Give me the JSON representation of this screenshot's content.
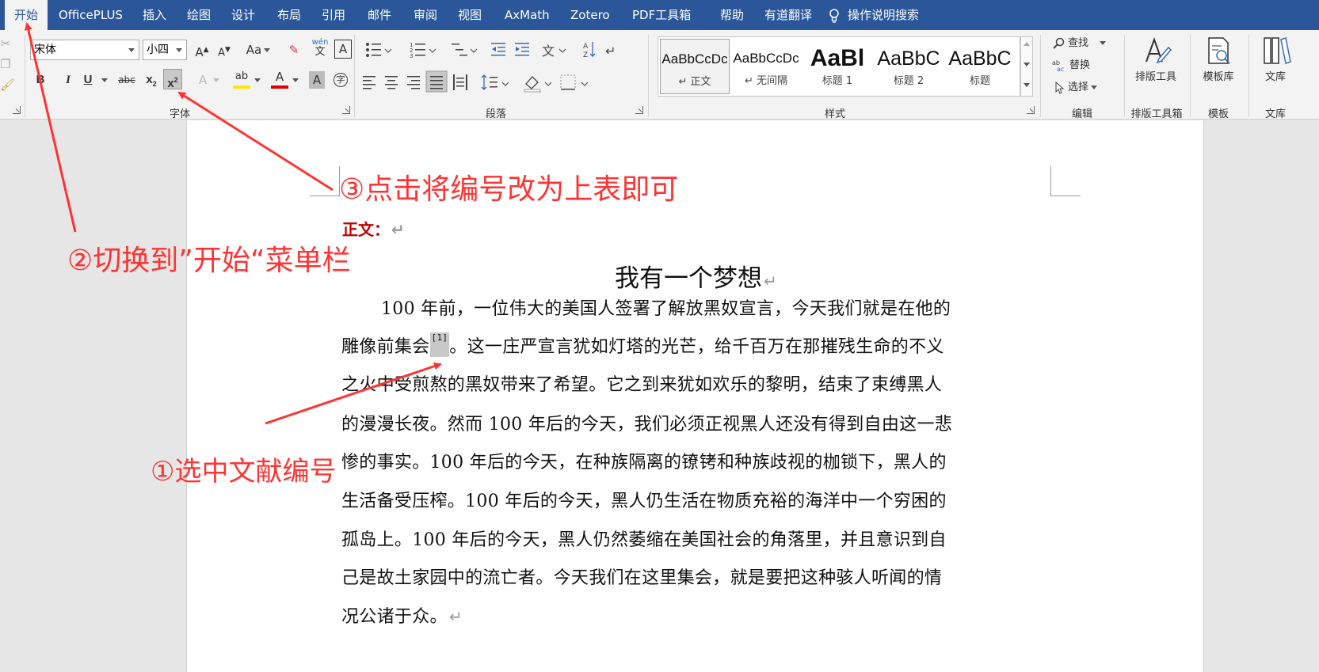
{
  "menubar": {
    "tabs": [
      {
        "label": "开始",
        "active": true
      },
      {
        "label": "OfficePLUS"
      },
      {
        "label": "插入"
      },
      {
        "label": "绘图"
      },
      {
        "label": "设计"
      },
      {
        "label": "布局"
      },
      {
        "label": "引用"
      },
      {
        "label": "邮件"
      },
      {
        "label": "审阅"
      },
      {
        "label": "视图"
      },
      {
        "label": "AxMath"
      },
      {
        "label": "Zotero"
      },
      {
        "label": "PDF工具箱"
      },
      {
        "label": "帮助"
      },
      {
        "label": "有道翻译"
      }
    ],
    "search_label": "操作说明搜索",
    "search_icon": "lightbulb-icon"
  },
  "ribbon": {
    "font_group": {
      "label": "字体",
      "font_name": "宋体",
      "font_size": "小四",
      "buttons": {
        "grow": "A",
        "shrink": "A",
        "case": "Aa",
        "phonetic_top": "wén",
        "phonetic_bottom": "文",
        "border_char": "A",
        "bold": "B",
        "italic": "I",
        "underline": "U",
        "strike": "abc",
        "subscript": "x",
        "subscript_sub": "2",
        "superscript": "x",
        "superscript_sup": "2",
        "text_effect": "A",
        "highlight": "ab",
        "font_color": "A",
        "char_shading": "A",
        "enclose": "字"
      }
    },
    "paragraph_group": {
      "label": "段落"
    },
    "styles_group": {
      "label": "样式",
      "styles": [
        {
          "sample": "AaBbCcDc",
          "name": "↵ 正文",
          "selected": true
        },
        {
          "sample": "AaBbCcDc",
          "name": "↵ 无间隔"
        },
        {
          "sample": "AaBl",
          "name": "标题 1"
        },
        {
          "sample": "AaBbC",
          "name": "标题 2"
        },
        {
          "sample": "AaBbC",
          "name": "标题"
        }
      ]
    },
    "editing_group": {
      "label": "编辑",
      "find": "查找",
      "replace": "替换",
      "select": "选择"
    },
    "layout_tool": {
      "button": "排版工具",
      "label": "排版工具箱"
    },
    "template": {
      "button": "模板库",
      "label": "模板"
    },
    "library": {
      "button": "文库",
      "label": "文库"
    }
  },
  "document": {
    "body_label": "正文：",
    "title": "我有一个梦想",
    "note_ref": "[1]",
    "lines": [
      "100 年前，一位伟大的美国人签署了解放黑奴宣言，今天我们就是在他的",
      "雕像前集会",
      "。这一庄严宣言犹如灯塔的光芒，给千百万在那摧残生命的不义",
      "之火中受煎熬的黑奴带来了希望。它之到来犹如欢乐的黎明，结束了束缚黑人",
      "的漫漫长夜。然而 100 年后的今天，我们必须正视黑人还没有得到自由这一悲",
      "惨的事实。100 年后的今天，在种族隔离的镣铐和种族歧视的枷锁下，黑人的",
      "生活备受压榨。100 年后的今天，黑人仍生活在物质充裕的海洋中一个穷困的",
      "孤岛上。100 年后的今天，黑人仍然萎缩在美国社会的角落里，并且意识到自",
      "己是故土家园中的流亡者。今天我们在这里集会，就是要把这种骇人听闻的情",
      "况公诸于众。"
    ],
    "return_mark": "↵"
  },
  "annotations": {
    "step1": "①选中文献编号",
    "step2": "②切换到”开始“菜单栏",
    "step3": "③点击将编号改为上表即可",
    "color": "#ff3333"
  },
  "colors": {
    "menubar": "#2b579a",
    "ribbon": "#f3f3f3",
    "page": "#ffffff",
    "workspace": "#e6e6e6"
  }
}
